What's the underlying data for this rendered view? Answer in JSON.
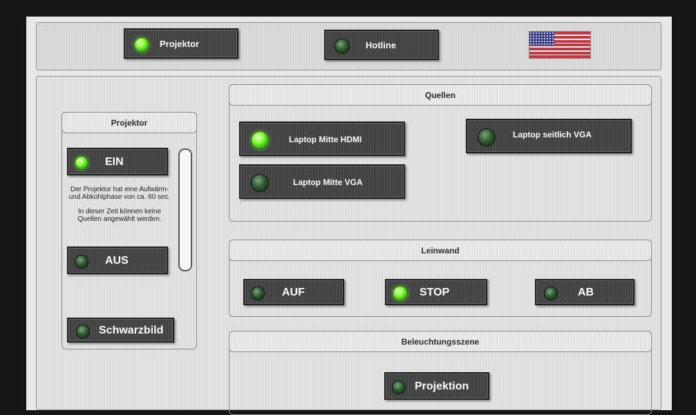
{
  "topbar": {
    "projektor_label": "Projektor",
    "hotline_label": "Hotline",
    "language_flag": "us-flag-icon"
  },
  "projektor_panel": {
    "title": "Projektor",
    "ein_label": "EIN",
    "aus_label": "AUS",
    "info_line1": "Der Projektor hat eine Aufwärm-",
    "info_line2": "und Abkühlphase von ca. 60 sec.",
    "info_line3": "In dieser Zeit können keine",
    "info_line4": "Quellen angewählt werden.",
    "schwarzbild_label": "Schwarzbild"
  },
  "quellen": {
    "title": "Quellen",
    "hdmi_label": "Laptop Mitte  HDMI",
    "vga_label": "Laptop Mitte  VGA",
    "seitlich_label": "Laptop seitlich  VGA"
  },
  "leinwand": {
    "title": "Leinwand",
    "auf_label": "AUF",
    "stop_label": "STOP",
    "ab_label": "AB"
  },
  "beleuchtung": {
    "title": "Beleuchtungsszene",
    "projektion_label": "Projektion"
  },
  "colors": {
    "led_on": "#7dff3c",
    "led_off": "#2f5a2f",
    "button": "#444444"
  }
}
